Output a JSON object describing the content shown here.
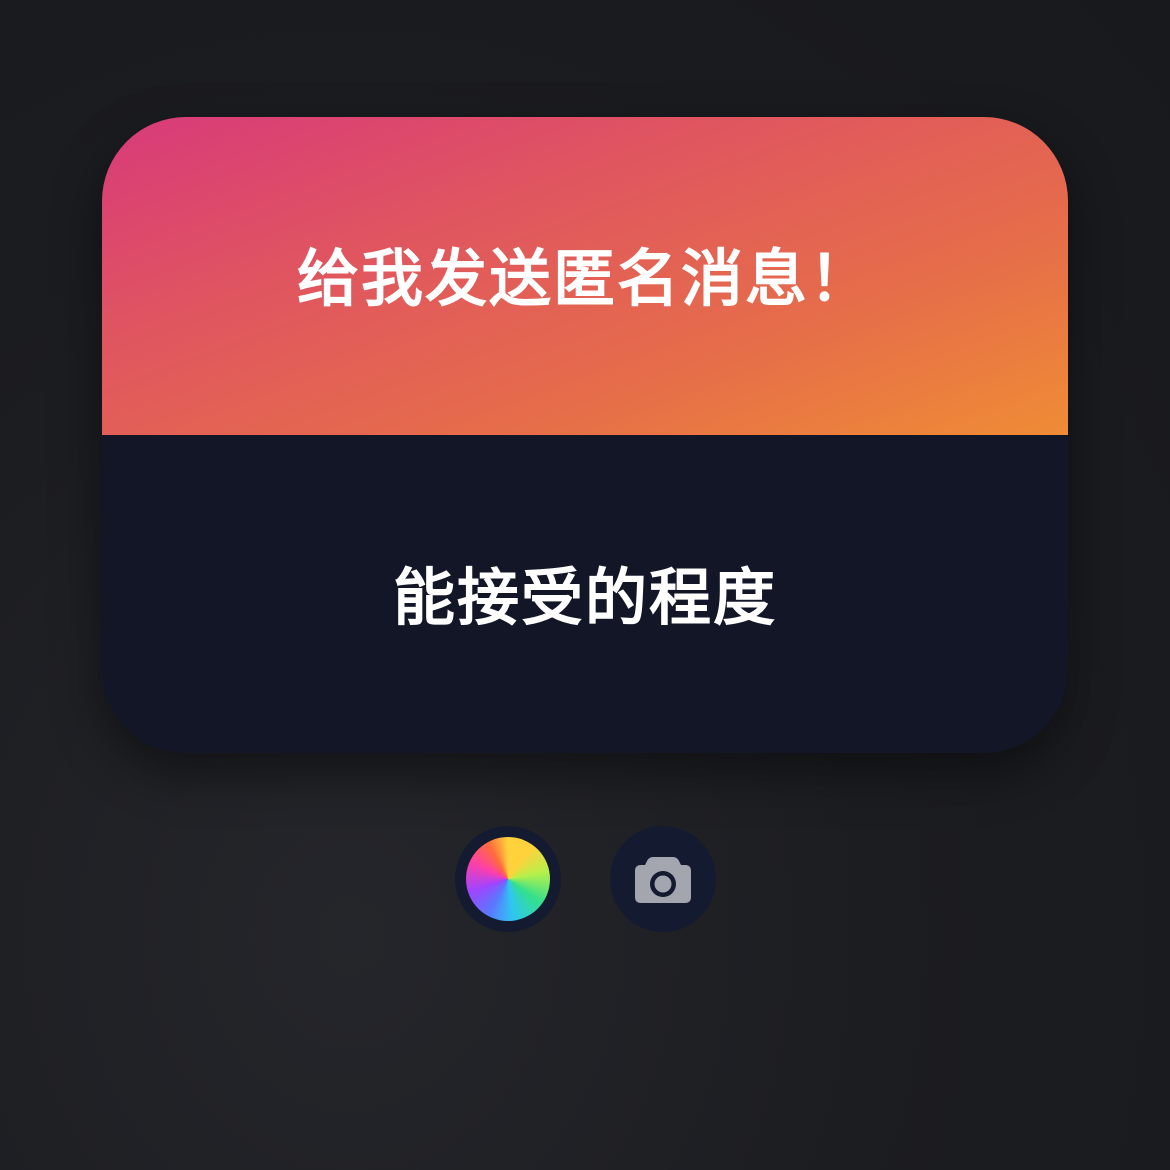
{
  "card": {
    "title": "给我发送匿名消息！",
    "message": "能接受的程度"
  },
  "tools": {
    "color_icon": "color-wheel-icon",
    "camera_icon": "camera-icon"
  },
  "colors": {
    "gradient_start": "#d83a7a",
    "gradient_end": "#ef8c35",
    "card_body": "#121626",
    "background": "#1c1d21",
    "tool_button_bg": "#141a30",
    "camera_icon": "#a3a6ae"
  }
}
